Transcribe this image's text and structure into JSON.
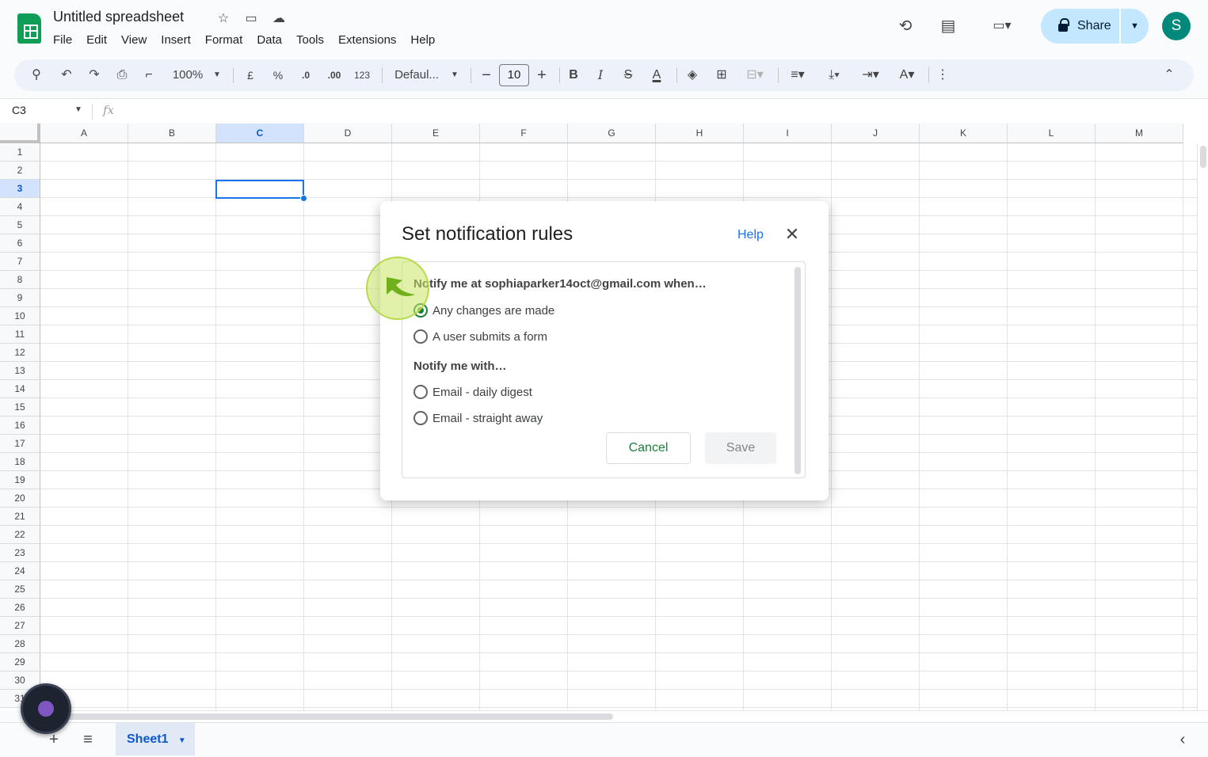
{
  "doc": {
    "title": "Untitled spreadsheet"
  },
  "menu": [
    "File",
    "Edit",
    "View",
    "Insert",
    "Format",
    "Data",
    "Tools",
    "Extensions",
    "Help"
  ],
  "share": {
    "label": "Share"
  },
  "avatar": {
    "initial": "S"
  },
  "toolbar": {
    "zoom": "100%",
    "currency": "£",
    "percent": "%",
    "dec_decrease": ".0",
    "dec_increase": ".00",
    "number_format": "123",
    "font": "Defaul...",
    "font_size": "10",
    "bold": "B",
    "italic": "I"
  },
  "formula": {
    "namebox": "C3",
    "fx": "fx"
  },
  "grid": {
    "columns": [
      "A",
      "B",
      "C",
      "D",
      "E",
      "F",
      "G",
      "H",
      "I",
      "J",
      "K",
      "L",
      "M"
    ],
    "selected_column": "C",
    "rows": [
      "1",
      "2",
      "3",
      "4",
      "5",
      "6",
      "7",
      "8",
      "9",
      "10",
      "11",
      "12",
      "13",
      "14",
      "15",
      "16",
      "17",
      "18",
      "19",
      "20",
      "21",
      "22",
      "23",
      "24",
      "25",
      "26",
      "27",
      "28",
      "29",
      "30",
      "31"
    ],
    "selected_row": "3"
  },
  "sheets": {
    "active": "Sheet1"
  },
  "dialog": {
    "title": "Set notification rules",
    "help": "Help",
    "notify_when_label": "Notify me at sophiaparker14oct@gmail.com when…",
    "when_options": [
      {
        "label": "Any changes are made",
        "selected": true
      },
      {
        "label": "A user submits a form",
        "selected": false
      }
    ],
    "notify_with_label": "Notify me with…",
    "with_options": [
      {
        "label": "Email - daily digest",
        "selected": false
      },
      {
        "label": "Email - straight away",
        "selected": false
      }
    ],
    "cancel": "Cancel",
    "save": "Save"
  }
}
